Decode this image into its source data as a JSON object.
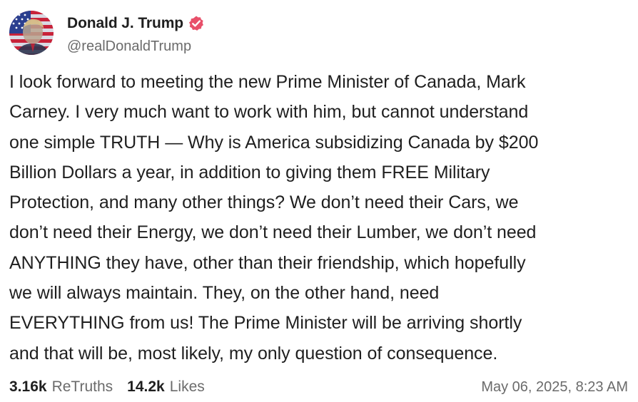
{
  "author": {
    "display_name": "Donald J. Trump",
    "handle": "@realDonaldTrump",
    "avatar_icon": "flag-portrait-avatar-icon",
    "verified_icon": "verified-badge-icon",
    "verified_color": "#e8506a"
  },
  "post": {
    "text": "I look forward to meeting the new Prime Minister of Canada, Mark\nCarney. I very much want to work with him, but cannot understand\none simple TRUTH — Why is America subsidizing Canada by $200\nBillion Dollars a year, in addition to giving them FREE Military\nProtection, and many other things? We don’t need their Cars, we\ndon’t need their Energy, we don’t need their Lumber, we don’t need\nANYTHING they have, other than their friendship, which hopefully\nwe will always maintain. They, on the other hand, need\nEVERYTHING from us! The Prime Minister will be arriving shortly\nand that will be, most likely, my only question of consequence."
  },
  "stats": {
    "retruths_count": "3.16k",
    "retruths_label": "ReTruths",
    "likes_count": "14.2k",
    "likes_label": "Likes"
  },
  "timestamp": "May 06, 2025, 8:23 AM"
}
